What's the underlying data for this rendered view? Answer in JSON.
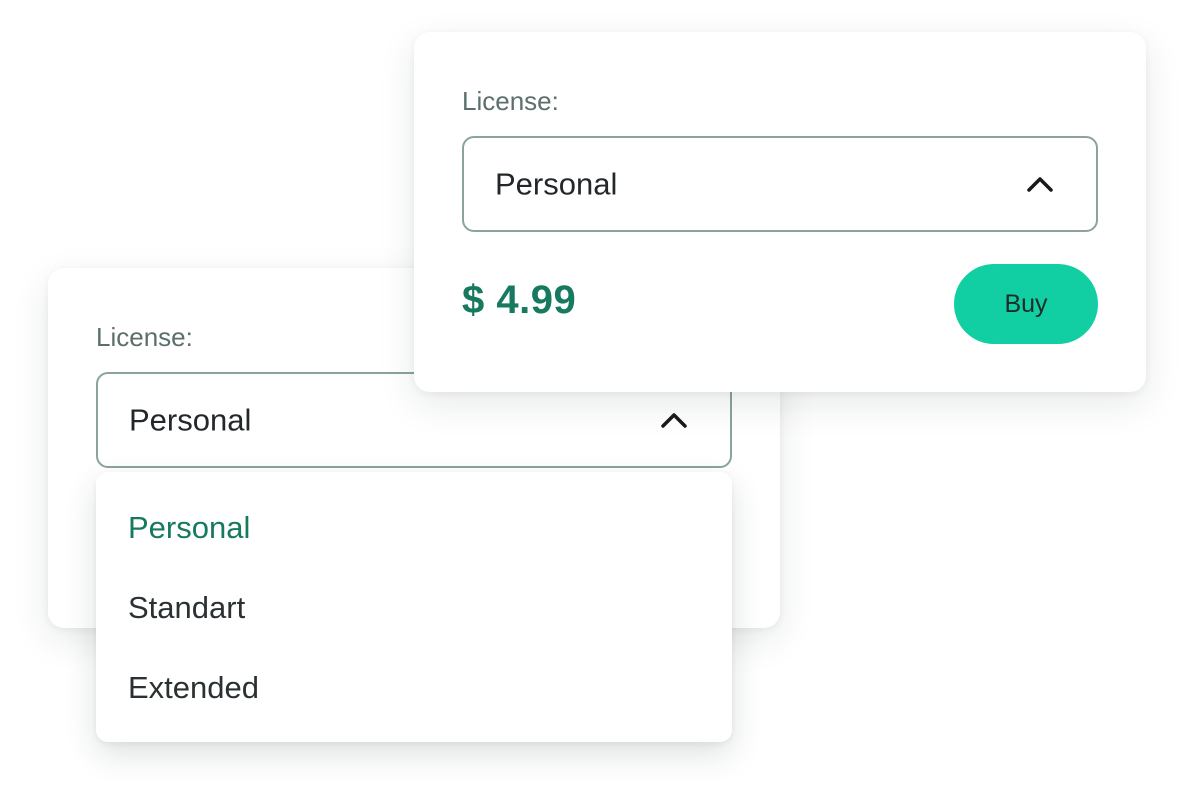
{
  "back_card": {
    "label": "License:",
    "select_value": "Personal",
    "chevron_icon": "chevron-up-icon",
    "dropdown": {
      "options": [
        "Personal",
        "Standart",
        "Extended"
      ],
      "selected": "Personal"
    }
  },
  "front_card": {
    "label": "License:",
    "select_value": "Personal",
    "chevron_icon": "chevron-up-icon",
    "price": "$ 4.99",
    "buy_label": "Buy"
  },
  "colors": {
    "accent_green": "#17795f",
    "buy_button": "#11cfa3",
    "select_border": "#8aa39e",
    "label_gray": "#5c6f6c"
  }
}
